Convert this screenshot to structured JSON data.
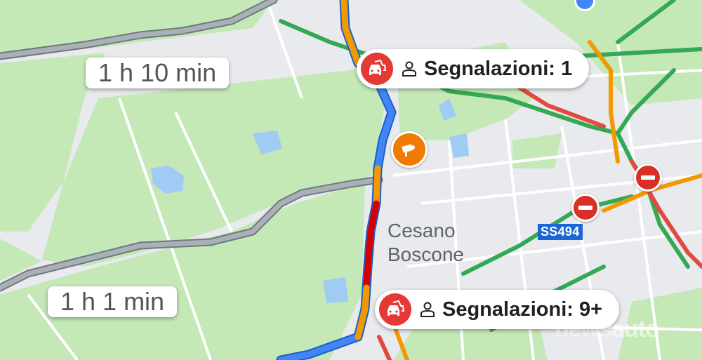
{
  "route_labels": {
    "alt_route_top": "1 h 10 min",
    "alt_route_bottom": "1 h 1 min"
  },
  "alerts": [
    {
      "icon": "traffic-incident-icon",
      "user_icon": "person-icon",
      "text": "Segnalazioni: 1"
    },
    {
      "icon": "traffic-incident-icon",
      "user_icon": "person-icon",
      "text": "Segnalazioni: 9+"
    }
  ],
  "place": {
    "line1": "Cesano",
    "line2": "Boscone"
  },
  "road_shield": "SS494",
  "markers": {
    "camera": "speed-camera-icon",
    "no_entry": "no-entry-icon"
  },
  "watermark": {
    "part1": "news",
    "part2": "auto"
  },
  "colors": {
    "park_green": "#c5e8b7",
    "map_bg": "#e8eaed",
    "route_blue": "#4285f4",
    "traffic_orange": "#f29900",
    "traffic_red": "#d50000",
    "alt_route_gray": "#8f979d",
    "traffic_green": "#34a853",
    "water": "#9fcbf5"
  }
}
